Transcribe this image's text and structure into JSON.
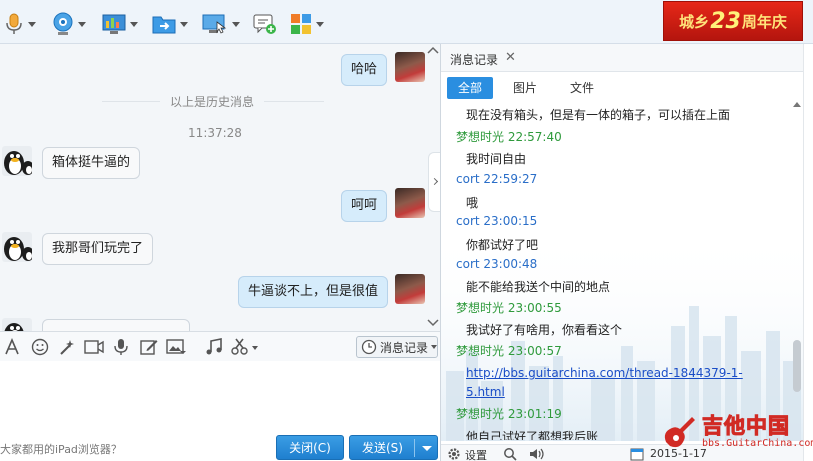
{
  "toolbar": {
    "icons": [
      "microphone-icon",
      "webcam-icon",
      "screen-share-icon",
      "file-transfer-icon",
      "remote-desktop-icon",
      "new-chat-icon",
      "apps-grid-icon"
    ]
  },
  "banner": {
    "prefix": "城乡",
    "number": "23",
    "suffix": "周年庆"
  },
  "chat": {
    "messages": [
      {
        "sender": "me",
        "text": "哈哈"
      },
      {
        "sender": "other",
        "text": "箱体挺牛逼的"
      },
      {
        "sender": "me",
        "text": "呵呵"
      },
      {
        "sender": "other",
        "text": "我那哥们玩完了"
      },
      {
        "sender": "me",
        "text": "牛逼谈不上，但是很值"
      }
    ],
    "history_divider": "以上是历史消息",
    "time": "11:37:28"
  },
  "input_toolbar": {
    "history_button": "消息记录"
  },
  "footer": {
    "hint": "大家都用的iPad浏览器？",
    "close_button": "关闭(C)",
    "send_button": "发送(S)"
  },
  "history_panel": {
    "title": "消息记录",
    "close": "✕",
    "tabs": [
      "全部",
      "图片",
      "文件"
    ],
    "active_tab": "全部",
    "entries": [
      {
        "type": "text",
        "text": "现在没有箱头，但是有一体的箱子，可以插在上面"
      },
      {
        "type": "head",
        "name": "梦想时光",
        "time": "22:57:40",
        "color": "#2f9a3c"
      },
      {
        "type": "text",
        "text": "我时间自由"
      },
      {
        "type": "head",
        "name": "cort",
        "time": "22:59:27",
        "color": "#2a6ec8"
      },
      {
        "type": "text",
        "text": "哦"
      },
      {
        "type": "head",
        "name": "cort",
        "time": "23:00:15",
        "color": "#2a6ec8"
      },
      {
        "type": "text",
        "text": "你都试好了吧"
      },
      {
        "type": "head",
        "name": "cort",
        "time": "23:00:48",
        "color": "#2a6ec8"
      },
      {
        "type": "text",
        "text": "能不能给我送个中间的地点"
      },
      {
        "type": "head",
        "name": "梦想时光",
        "time": "23:00:55",
        "color": "#2f9a3c"
      },
      {
        "type": "text",
        "text": "我试好了有啥用，你看看这个"
      },
      {
        "type": "head",
        "name": "梦想时光",
        "time": "23:00:57",
        "color": "#2f9a3c"
      },
      {
        "type": "link",
        "text": "http://bbs.guitarchina.com/thread-1844379-1-"
      },
      {
        "type": "link",
        "text": "5.html"
      },
      {
        "type": "head",
        "name": "梦想时光",
        "time": "23:01:19",
        "color": "#2f9a3c"
      },
      {
        "type": "text",
        "text": "他自己试好了都想我后账"
      }
    ],
    "footer_settings": "设置",
    "footer_date": "2015-1-17"
  },
  "watermark": {
    "title": "吉他中国",
    "sub": "bbs.GuitarChina.com"
  },
  "colors": {
    "accent": "#2a8ee0",
    "green_name": "#2f9a3c",
    "blue_name": "#2a6ec8",
    "link": "#1a4dc7"
  }
}
